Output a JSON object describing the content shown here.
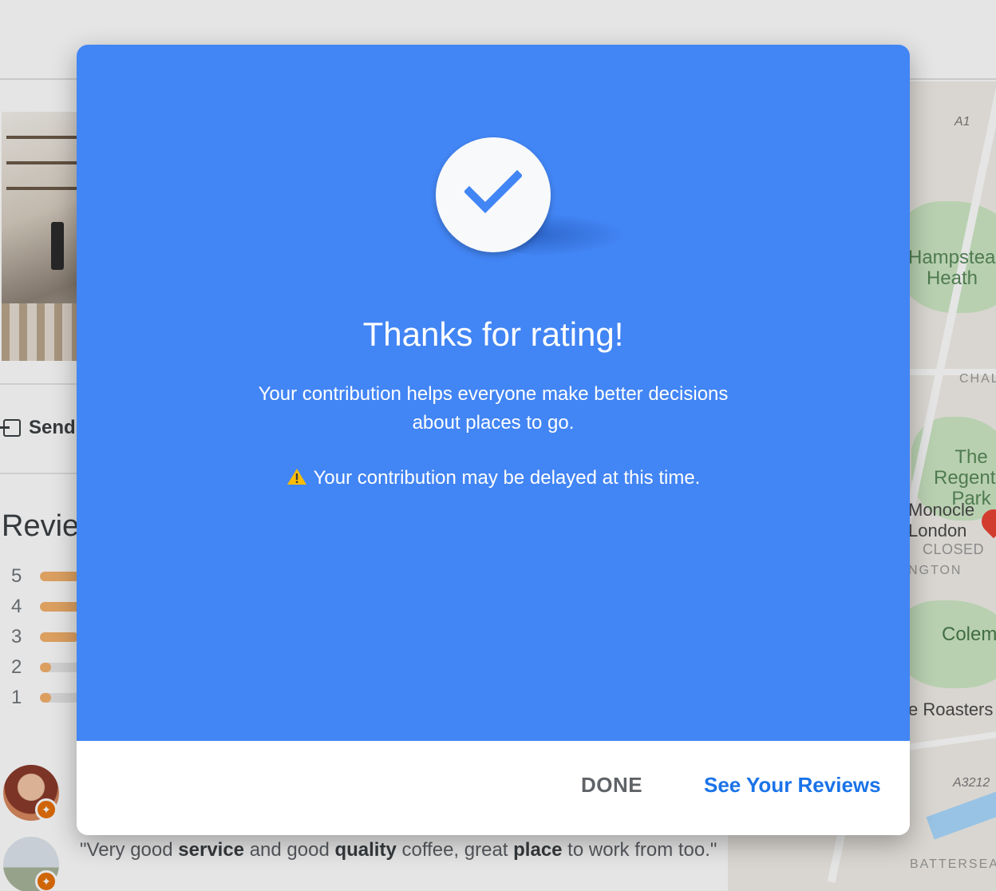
{
  "background": {
    "send_label": "Send",
    "reviews_heading": "Reviews",
    "rating_rows": [
      {
        "stars": "5",
        "fraction": 0.8
      },
      {
        "stars": "4",
        "fraction": 0.55
      },
      {
        "stars": "3",
        "fraction": 0.4
      },
      {
        "stars": "2",
        "fraction": 0.12
      },
      {
        "stars": "1",
        "fraction": 0.12
      }
    ],
    "review": {
      "open_quote": "\"Very good ",
      "word_service": "service",
      "text_and": " and good ",
      "word_quality": "quality",
      "text_coffee": " coffee, great ",
      "word_place": "place",
      "text_end": " to work from too.\""
    },
    "map": {
      "road_a1": "A1",
      "hampstead": "Hampstead Heath",
      "chalk": "CHAL",
      "regents": "The Regent's Park",
      "monocle": "Monocle London",
      "closed": "CLOSED",
      "ngton": "NGTON",
      "colem": "Colem",
      "roasters": "e Roasters",
      "road_a3212": "A3212",
      "battersea": "BATTERSEA"
    }
  },
  "dialog": {
    "title": "Thanks for rating!",
    "body": "Your contribution helps everyone make better decisions about places to go.",
    "warning": "Your contribution may be delayed at this time.",
    "done_label": "DONE",
    "see_reviews_label": "See Your Reviews",
    "accent_color": "#4285f4",
    "link_color": "#1a73e8",
    "icons": {
      "check": "check-icon",
      "warning": "warning-icon"
    }
  }
}
